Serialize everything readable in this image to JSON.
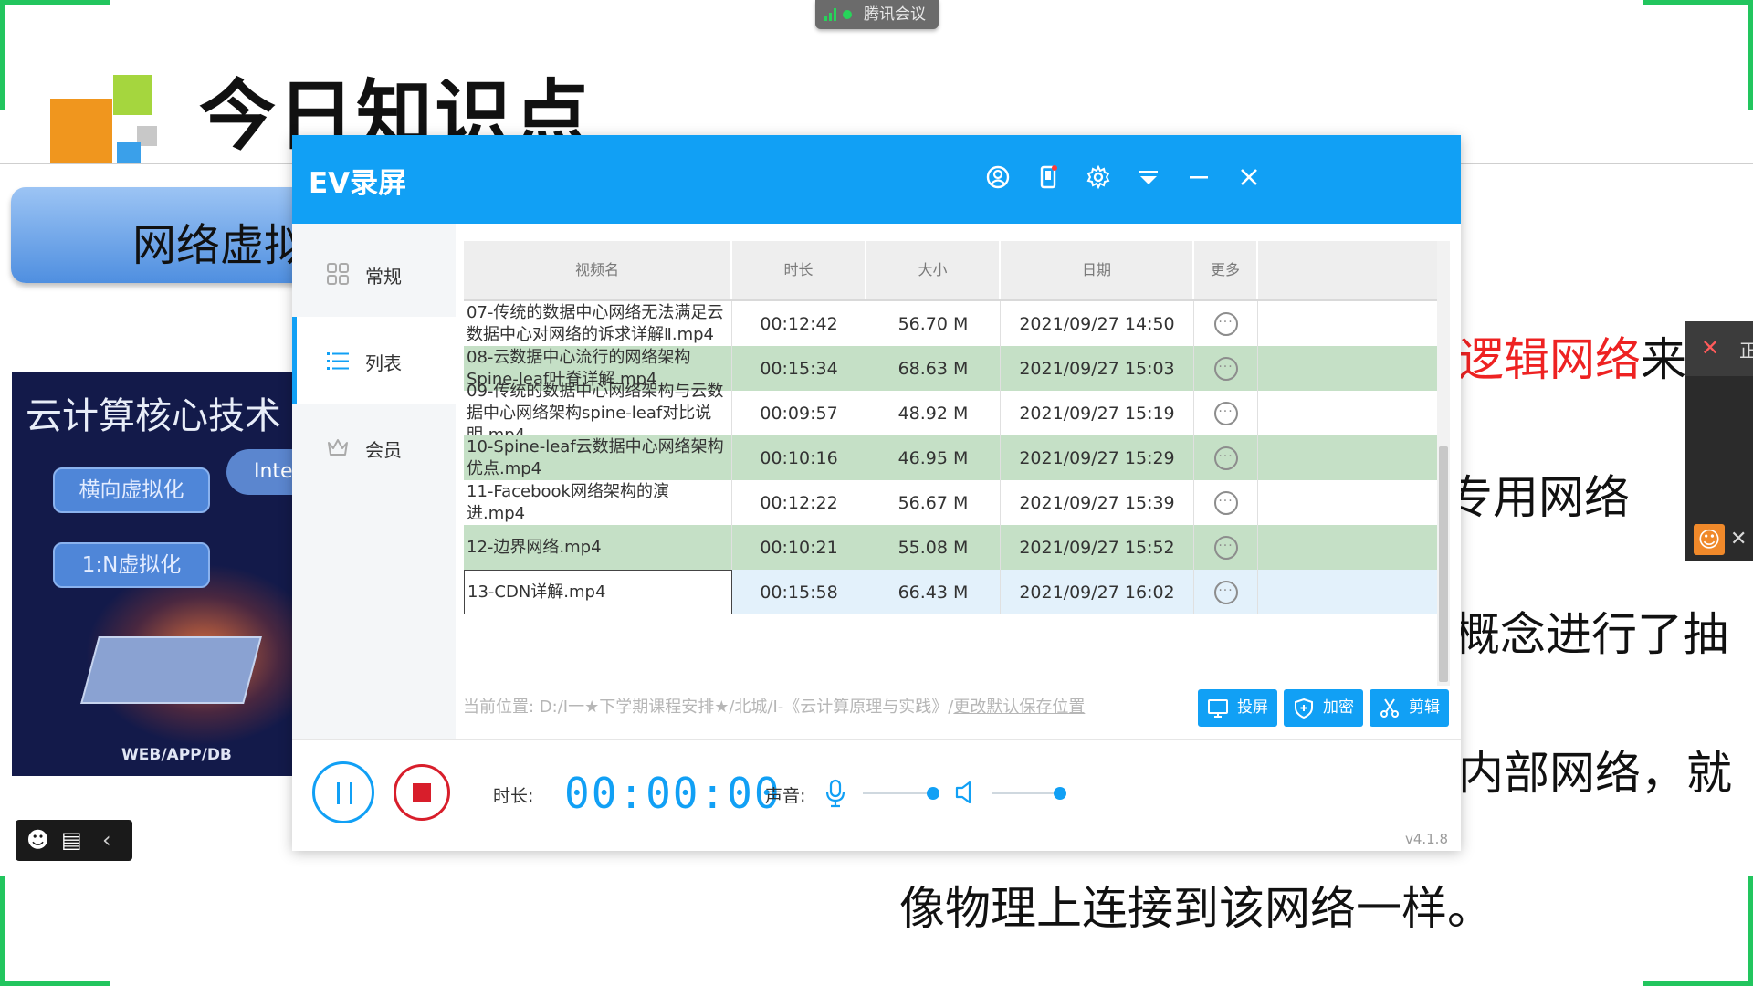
{
  "slide": {
    "title": "今日知识点",
    "pill_label": "网络虚拟",
    "image_title": "云计算核心技术",
    "image_badge_1": "横向虚拟化",
    "image_badge_2": "1:N虚拟化",
    "image_cloud": "Inte",
    "image_footer": "WEB/APP/DB",
    "body_line_1_red": "逻辑网络",
    "body_line_1_rest": "来",
    "body_line_2": "专用网络",
    "body_line_3": "概念进行了抽",
    "body_line_4": "内部网络，就",
    "body_line_5": "像物理上连接到该网络一样。"
  },
  "meeting": {
    "app_label": "腾讯会议"
  },
  "side_panel": {
    "label": "正"
  },
  "ev": {
    "title": "EV录屏",
    "titlebar_icons": [
      "user-icon",
      "phone-icon",
      "gear-icon",
      "dropdown-icon",
      "minimize-icon",
      "close-icon"
    ],
    "nav": [
      {
        "label": "常规",
        "icon": "grid-icon"
      },
      {
        "label": "列表",
        "icon": "list-icon"
      },
      {
        "label": "会员",
        "icon": "crown-icon"
      }
    ],
    "table": {
      "headers": [
        "视频名",
        "时长",
        "大小",
        "日期",
        "更多"
      ],
      "rows": [
        {
          "name": "07-传统的数据中心网络无法满足云数据中心对网络的诉求详解Ⅱ.mp4",
          "duration": "00:12:42",
          "size": "56.70 M",
          "date": "2021/09/27 14:50"
        },
        {
          "name": "08-云数据中心流行的网络架构Spine-leaf叶脊详解.mp4",
          "duration": "00:15:34",
          "size": "68.63 M",
          "date": "2021/09/27 15:03"
        },
        {
          "name": "09-传统的数据中心网络架构与云数据中心网络架构spine-leaf对比说明.mp4",
          "duration": "00:09:57",
          "size": "48.92 M",
          "date": "2021/09/27 15:19"
        },
        {
          "name": "10-Spine-leaf云数据中心网络架构优点.mp4",
          "duration": "00:10:16",
          "size": "46.95 M",
          "date": "2021/09/27 15:29"
        },
        {
          "name": "11-Facebook网络架构的演进.mp4",
          "duration": "00:12:22",
          "size": "56.67 M",
          "date": "2021/09/27 15:39"
        },
        {
          "name": "12-边界网络.mp4",
          "duration": "00:10:21",
          "size": "55.08 M",
          "date": "2021/09/27 15:52"
        },
        {
          "name": "13-CDN详解.mp4",
          "duration": "00:15:58",
          "size": "66.43 M",
          "date": "2021/09/27 16:02"
        }
      ]
    },
    "path_prefix": "当前位置: D:/Ⅰ一★下学期课程安排★/北城/Ⅰ-《云计算原理与实践》/",
    "path_link": "更改默认保存位置",
    "actions": {
      "cast": "投屏",
      "encrypt": "加密",
      "edit": "剪辑"
    },
    "duration_label": "时长:",
    "timer": "00:00:00",
    "sound_label": "声音:",
    "version": "v4.1.8",
    "colors": {
      "accent": "#11a0f5",
      "row_highlight": "#c5e0c6",
      "stop": "#d81e2b"
    }
  }
}
